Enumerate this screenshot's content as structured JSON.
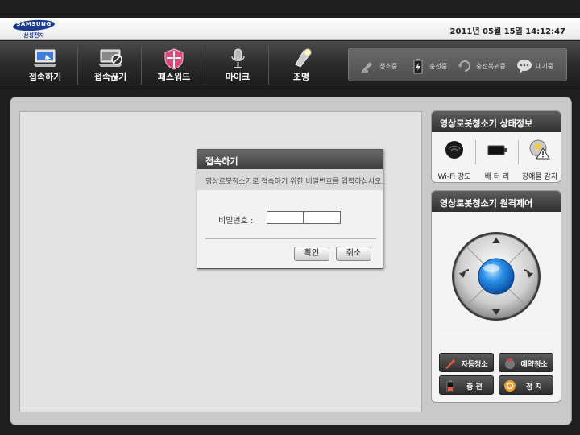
{
  "header": {
    "logo_text": "SAMSUNG",
    "logo_subtext": "삼성전자",
    "datetime": "2011년 05월 15일 14:12:47"
  },
  "toolbar": {
    "items": [
      {
        "label": "접속하기",
        "icon": "laptop-connect-icon"
      },
      {
        "label": "접속끊기",
        "icon": "laptop-disconnect-icon"
      },
      {
        "label": "패스워드",
        "icon": "shield-icon"
      },
      {
        "label": "마이크",
        "icon": "microphone-icon"
      },
      {
        "label": "조명",
        "icon": "flashlight-icon"
      }
    ],
    "status": [
      {
        "label": "청소중",
        "icon": "vacuum-icon"
      },
      {
        "label": "충전중",
        "icon": "charging-icon"
      },
      {
        "label": "충전복귀중",
        "icon": "return-icon"
      },
      {
        "label": "대기중",
        "icon": "standby-icon"
      }
    ]
  },
  "dialog": {
    "title": "접속하기",
    "message": "영상로봇청소기로 접속하기 위한 비밀번호를 입력하십시오.",
    "password_label": "비밀번호 :",
    "confirm_label": "확인",
    "cancel_label": "취소"
  },
  "status_panel": {
    "title": "영상로봇청소기 상태정보",
    "items": [
      {
        "label": "Wi-Fi 강도",
        "icon": "wifi-icon"
      },
      {
        "label": "배 터 리",
        "icon": "battery-icon"
      },
      {
        "label": "장애물 감지",
        "icon": "obstacle-warning-icon"
      }
    ]
  },
  "control_panel": {
    "title": "영상로봇청소기 원격제어",
    "buttons": [
      {
        "label": "자동청소",
        "icon": "auto-clean-icon"
      },
      {
        "label": "예약청소",
        "icon": "schedule-clean-icon"
      },
      {
        "label": "충   전",
        "icon": "charge-icon"
      },
      {
        "label": "정   지",
        "icon": "stop-icon"
      }
    ]
  },
  "colors": {
    "accent_blue": "#1e7fd8",
    "shield_pink": "#d94a7a",
    "toolbar_dark": "#2b2b2b"
  }
}
